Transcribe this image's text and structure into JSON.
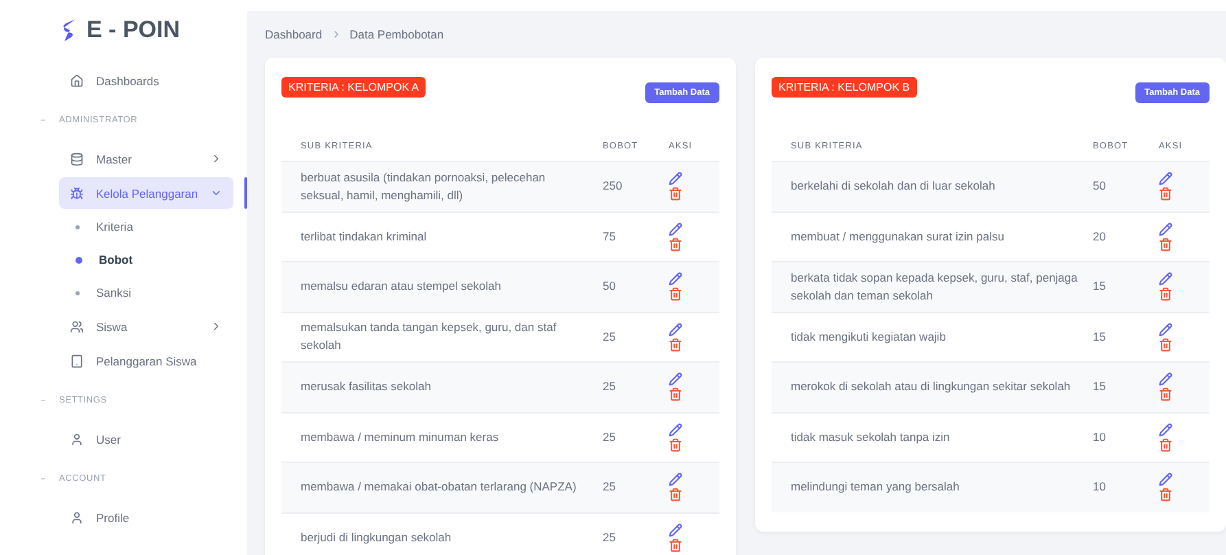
{
  "brand": {
    "name": "E - POIN"
  },
  "sidebar": {
    "items": [
      {
        "kind": "link",
        "label": "Dashboards",
        "selected": false
      },
      {
        "kind": "section",
        "label": "ADMINISTRATOR"
      },
      {
        "kind": "group",
        "label": "Master",
        "selected": false,
        "expanded": false
      },
      {
        "kind": "group",
        "label": "Kelola Pelanggaran",
        "selected": true,
        "expanded": true,
        "children": [
          {
            "label": "Kriteria",
            "selected": false
          },
          {
            "label": "Bobot",
            "selected": true
          },
          {
            "label": "Sanksi",
            "selected": false
          }
        ]
      },
      {
        "kind": "group",
        "label": "Siswa",
        "selected": false,
        "expanded": false
      },
      {
        "kind": "link",
        "label": "Pelanggaran Siswa",
        "selected": false
      },
      {
        "kind": "section",
        "label": "SETTINGS"
      },
      {
        "kind": "link",
        "label": "User",
        "selected": false
      },
      {
        "kind": "section",
        "label": "ACCOUNT"
      },
      {
        "kind": "link",
        "label": "Profile",
        "selected": false
      }
    ]
  },
  "breadcrumb": [
    "Dashboard",
    "Data Pembobotan"
  ],
  "cards": [
    {
      "title": "KRITERIA : KELOMPOK A",
      "button": "Tambah Data",
      "columns": [
        "SUB KRITERIA",
        "BOBOT",
        "AKSI"
      ],
      "rows": [
        {
          "sub": "berbuat asusila (tindakan pornoaksi, pelecehan seksual, hamil, menghamili, dll)",
          "bobot": "250"
        },
        {
          "sub": "terlibat tindakan kriminal",
          "bobot": "75"
        },
        {
          "sub": "memalsu edaran atau stempel sekolah",
          "bobot": "50"
        },
        {
          "sub": "memalsukan tanda tangan kepsek, guru, dan staf sekolah",
          "bobot": "25"
        },
        {
          "sub": "merusak fasilitas sekolah",
          "bobot": "25"
        },
        {
          "sub": "membawa / meminum minuman keras",
          "bobot": "25"
        },
        {
          "sub": "membawa / memakai obat-obatan terlarang (NAPZA)",
          "bobot": "25"
        },
        {
          "sub": "berjudi di lingkungan sekolah",
          "bobot": "25"
        }
      ]
    },
    {
      "title": "KRITERIA : KELOMPOK B",
      "button": "Tambah Data",
      "columns": [
        "SUB KRITERIA",
        "BOBOT",
        "AKSI"
      ],
      "rows": [
        {
          "sub": "berkelahi di sekolah dan di luar sekolah",
          "bobot": "50"
        },
        {
          "sub": "membuat / menggunakan surat izin palsu",
          "bobot": "20"
        },
        {
          "sub": "berkata tidak sopan kepada kepsek, guru, staf, penjaga sekolah dan teman sekolah",
          "bobot": "15"
        },
        {
          "sub": "tidak mengikuti kegiatan wajib",
          "bobot": "15"
        },
        {
          "sub": "merokok di sekolah atau di lingkungan sekitar sekolah",
          "bobot": "15"
        },
        {
          "sub": "tidak masuk sekolah tanpa izin",
          "bobot": "10"
        },
        {
          "sub": "melindungi teman yang bersalah",
          "bobot": "10"
        }
      ]
    }
  ]
}
